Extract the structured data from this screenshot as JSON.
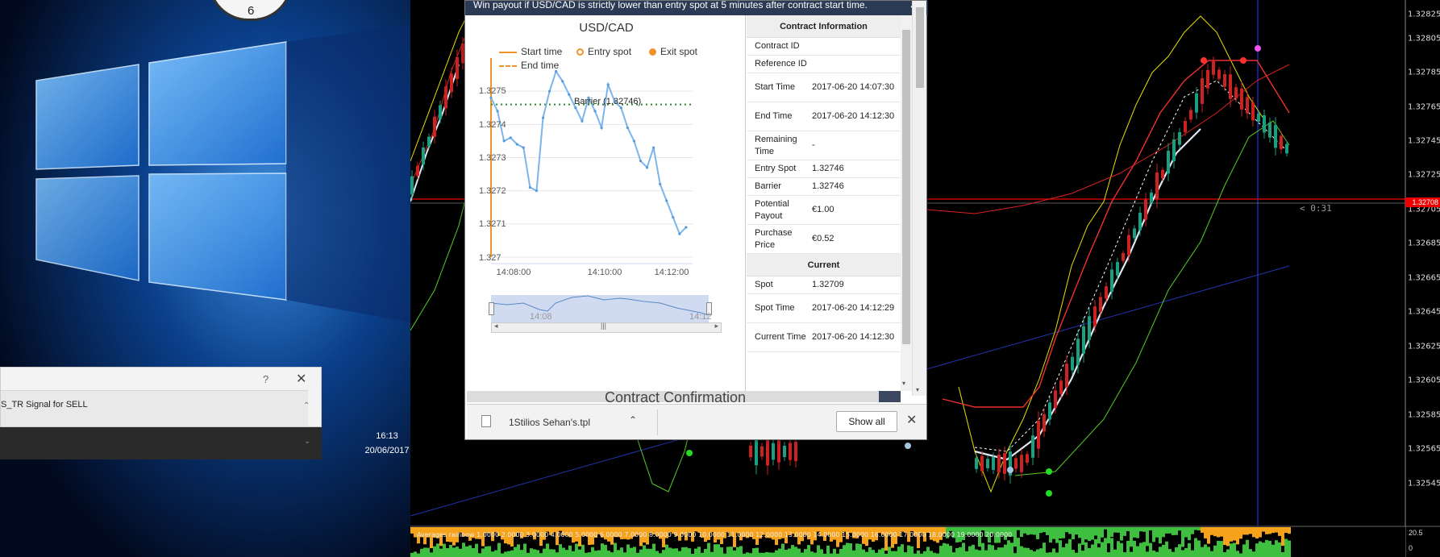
{
  "taskbar": {
    "dialog": {
      "text": "S_TR Signal for SELL",
      "help": "?",
      "close": "✕",
      "scroll_up": "⌃",
      "collapse": "⌄"
    },
    "clock": {
      "time": "16:13",
      "date": "20/06/2017"
    },
    "analog_clock_numeral": "6"
  },
  "popup": {
    "header": "Win payout if USD/CAD is strictly lower than entry spot at 5 minutes after contract start time.",
    "close": "✕",
    "chart": {
      "title": "USD/CAD",
      "legend": {
        "start_time": "Start time",
        "entry_spot": "Entry spot",
        "exit_spot": "Exit spot",
        "end_time": "End time"
      },
      "barrier_label": "Barrier (1.32746)",
      "navigator_labels": [
        "14:08",
        "14:12"
      ],
      "navigator_scroll": {
        "left": "◂",
        "middle": "|||",
        "right": "▸"
      }
    },
    "contract_info": {
      "title": "Contract Information",
      "rows": [
        {
          "label": "Contract ID",
          "value": ""
        },
        {
          "label": "Reference ID",
          "value": ""
        },
        {
          "label": "Start Time",
          "value": "2017-06-20 14:07:30"
        },
        {
          "label": "End Time",
          "value": "2017-06-20 14:12:30"
        },
        {
          "label": "Remaining Time",
          "value": "-"
        },
        {
          "label": "Entry Spot",
          "value": "1.32746"
        },
        {
          "label": "Barrier",
          "value": "1.32746"
        },
        {
          "label": "Potential Payout",
          "value": "€1.00"
        },
        {
          "label": "Purchase Price",
          "value": "€0.52"
        }
      ]
    },
    "current": {
      "title": "Current",
      "rows": [
        {
          "label": "Spot",
          "value": "1.32709"
        },
        {
          "label": "Spot Time",
          "value": "2017-06-20 14:12:29"
        },
        {
          "label": "Current Time",
          "value": "2017-06-20 14:12:30"
        }
      ]
    },
    "confirmation_peek": "Contract Confirmation",
    "download_bar": {
      "file_name": "1Stilios Sehan's.tpl",
      "show_all": "Show all",
      "close": "✕",
      "chevron": "⌃"
    },
    "scroll_down": "▾"
  },
  "chart_data": [
    {
      "type": "line",
      "title": "USD/CAD",
      "x_range": [
        "14:07:30",
        "14:12:40"
      ],
      "xticks": [
        "14:08:00",
        "14:10:00",
        "14:12:00"
      ],
      "ylim": [
        1.327,
        1.3276
      ],
      "yticks": [
        "1.327",
        "1.3271",
        "1.3272",
        "1.3273",
        "1.3274",
        "1.3275"
      ],
      "barrier": 1.32746,
      "series": [
        {
          "name": "USD/CAD",
          "x": [
            "14:07:30",
            "14:07:40",
            "14:07:50",
            "14:08:00",
            "14:08:10",
            "14:08:20",
            "14:08:30",
            "14:08:40",
            "14:08:50",
            "14:09:00",
            "14:09:10",
            "14:09:20",
            "14:09:30",
            "14:09:40",
            "14:09:50",
            "14:10:00",
            "14:10:10",
            "14:10:20",
            "14:10:30",
            "14:10:40",
            "14:10:50",
            "14:11:00",
            "14:11:10",
            "14:11:20",
            "14:11:30",
            "14:11:40",
            "14:11:50",
            "14:12:00",
            "14:12:10",
            "14:12:20",
            "14:12:30"
          ],
          "y": [
            1.32748,
            1.32744,
            1.32735,
            1.32736,
            1.32734,
            1.32733,
            1.32721,
            1.3272,
            1.32742,
            1.3275,
            1.32756,
            1.32753,
            1.32749,
            1.32745,
            1.32741,
            1.32748,
            1.32744,
            1.32739,
            1.32752,
            1.32747,
            1.32745,
            1.32739,
            1.32735,
            1.32729,
            1.32727,
            1.32733,
            1.32722,
            1.32717,
            1.32712,
            1.32707,
            1.32709
          ]
        }
      ]
    },
    {
      "type": "line",
      "title": "",
      "yticks": [
        "1.32825",
        "1.32805",
        "1.32785",
        "1.32765",
        "1.32745",
        "1.32725",
        "1.32705",
        "1.32685",
        "1.32665",
        "1.32645",
        "1.32625",
        "1.32605",
        "1.32585",
        "1.32565",
        "1.32545"
      ],
      "ylim": [
        1.3254,
        1.3283
      ],
      "current_price": "1.32708",
      "countdown": "< 0:31",
      "indicator_label": "Averages rainbow 1.0000 2.0000 3.0000 4.0000 5.0000 6.0000 7.0000 8.0000 9.0000 10.0000 11.0000 12.0000 13.0000 14.0000 15.0000 16.0000 17.0000 18.0000 19.0000 20.0000",
      "indicator_yticks": [
        "20.5",
        "0"
      ]
    }
  ],
  "colors": {
    "accent": "#f0932b",
    "line": "#7cb5ec",
    "barrier": "#2a8a2a",
    "price_tag": "#e00000",
    "rainbow_green": "#3fbf3f",
    "rainbow_orange": "#f7a21b"
  }
}
